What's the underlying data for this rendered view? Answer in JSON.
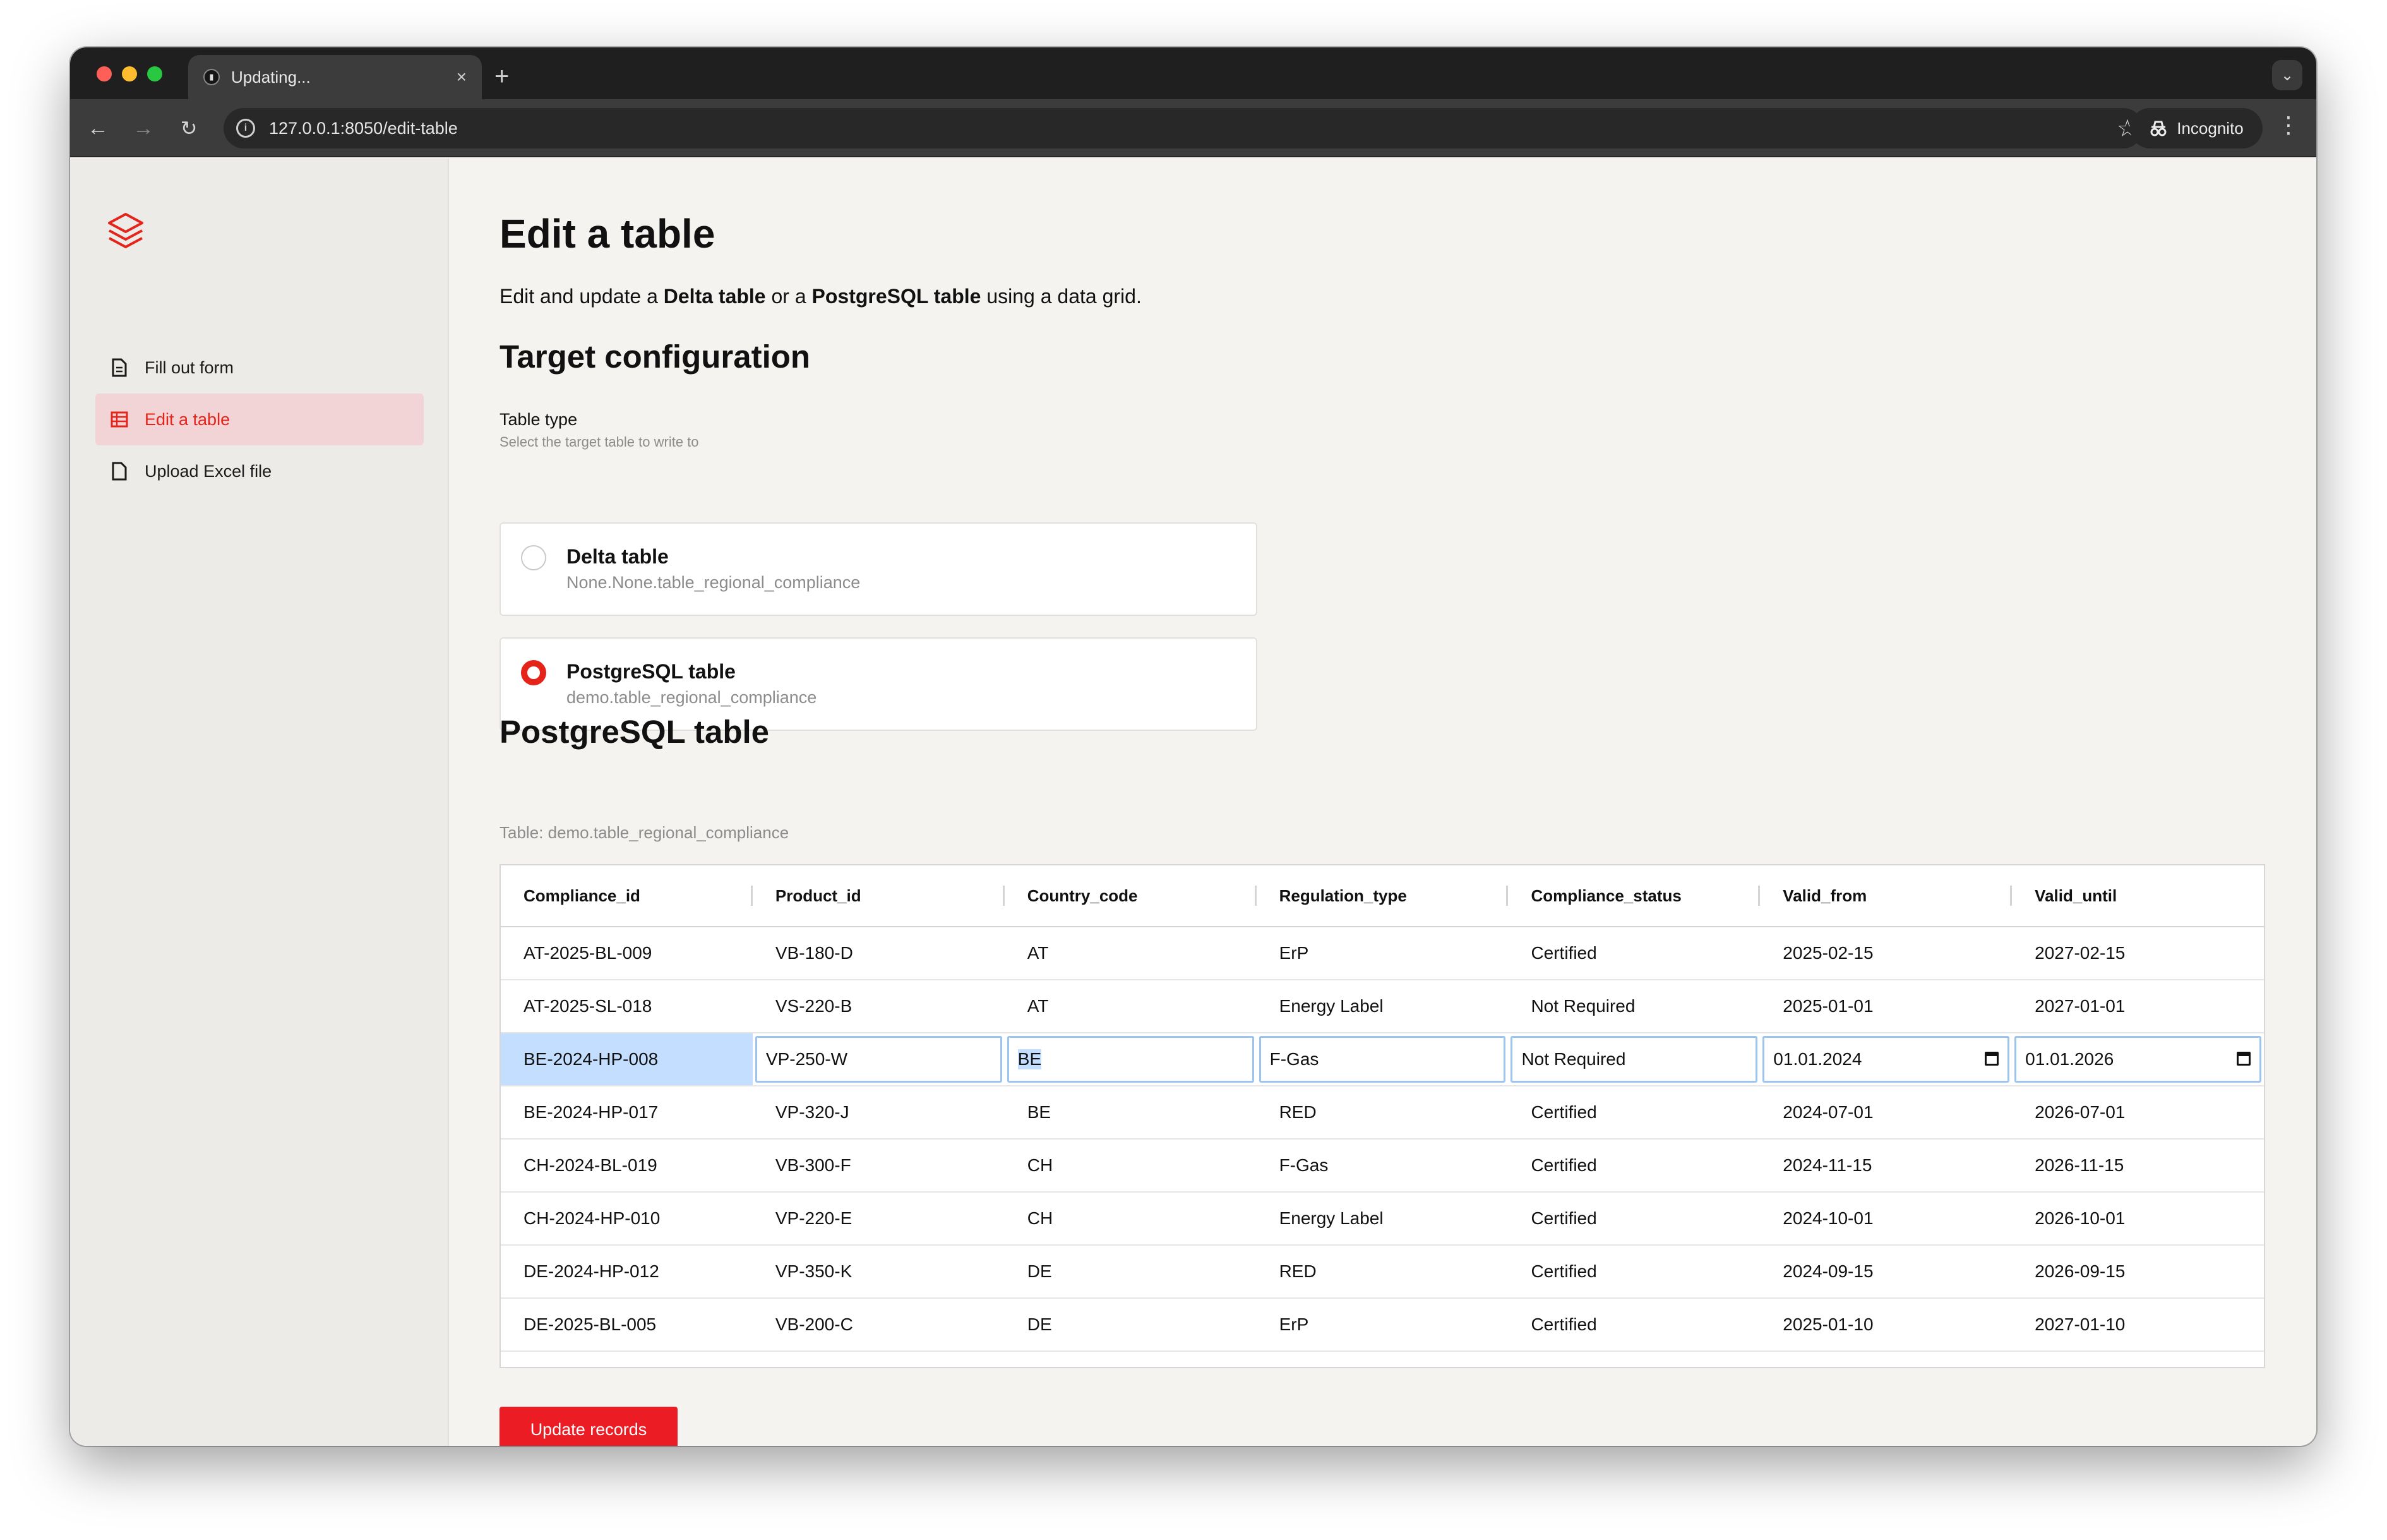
{
  "browser": {
    "tab_title": "Updating...",
    "tab_close": "×",
    "new_tab": "+",
    "url": "127.0.0.1:8050/edit-table",
    "incognito_label": "Incognito"
  },
  "sidebar": {
    "items": [
      {
        "label": "Fill out form",
        "icon": "document-icon"
      },
      {
        "label": "Edit a table",
        "icon": "table-icon"
      },
      {
        "label": "Upload Excel file",
        "icon": "file-icon"
      }
    ]
  },
  "page": {
    "title": "Edit a table",
    "desc_pre": "Edit and update a ",
    "desc_b1": "Delta table",
    "desc_mid": " or a ",
    "desc_b2": "PostgreSQL table",
    "desc_post": " using a data grid.",
    "target_heading": "Target configuration",
    "table_type_label": "Table type",
    "table_type_help": "Select the target table to write to",
    "options": [
      {
        "title": "Delta table",
        "subtitle": "None.None.table_regional_compliance",
        "selected": false
      },
      {
        "title": "PostgreSQL table",
        "subtitle": "demo.table_regional_compliance",
        "selected": true
      }
    ],
    "section_heading": "PostgreSQL table",
    "table_caption": "Table: demo.table_regional_compliance",
    "update_button": "Update records"
  },
  "grid": {
    "columns": [
      "Compliance_id",
      "Product_id",
      "Country_code",
      "Regulation_type",
      "Compliance_status",
      "Valid_from",
      "Valid_until"
    ],
    "rows": [
      [
        "AT-2025-BL-009",
        "VB-180-D",
        "AT",
        "ErP",
        "Certified",
        "2025-02-15",
        "2027-02-15"
      ],
      [
        "AT-2025-SL-018",
        "VS-220-B",
        "AT",
        "Energy Label",
        "Not Required",
        "2025-01-01",
        "2027-01-01"
      ],
      [
        "BE-2024-HP-008",
        "VP-250-W",
        "BE",
        "F-Gas",
        "Not Required",
        "01.01.2024",
        "01.01.2026"
      ],
      [
        "BE-2024-HP-017",
        "VP-320-J",
        "BE",
        "RED",
        "Certified",
        "2024-07-01",
        "2026-07-01"
      ],
      [
        "CH-2024-BL-019",
        "VB-300-F",
        "CH",
        "F-Gas",
        "Certified",
        "2024-11-15",
        "2026-11-15"
      ],
      [
        "CH-2024-HP-010",
        "VP-220-E",
        "CH",
        "Energy Label",
        "Certified",
        "2024-10-01",
        "2026-10-01"
      ],
      [
        "DE-2024-HP-012",
        "VP-350-K",
        "DE",
        "RED",
        "Certified",
        "2024-09-15",
        "2026-09-15"
      ],
      [
        "DE-2025-BL-005",
        "VB-200-C",
        "DE",
        "ErP",
        "Certified",
        "2025-01-10",
        "2027-01-10"
      ]
    ],
    "editing_row_index": 2
  },
  "colors": {
    "accent": "#e4231b",
    "button": "#ec1c24",
    "selection": "#c3deff",
    "active_nav_bg": "#f2d4d6"
  }
}
